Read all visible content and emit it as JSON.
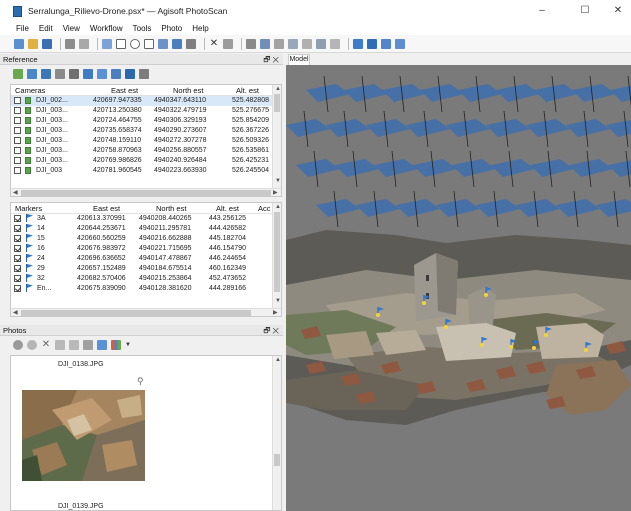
{
  "window": {
    "title": "Serralunga_Rilievo-Drone.psx* — Agisoft PhotoScan",
    "minimize": "–",
    "maximize": "☐",
    "close": "✕"
  },
  "menu": [
    "File",
    "Edit",
    "View",
    "Workflow",
    "Tools",
    "Photo",
    "Help"
  ],
  "reference": {
    "title": "Reference",
    "panel_buttons": "🗗 ✕",
    "cameras": {
      "headers": [
        "Cameras",
        "East est",
        "North est",
        "Alt. est"
      ],
      "rows": [
        {
          "name": "DJI_002...",
          "east": "420697.947335",
          "north": "4940347.643110",
          "alt": "525.482808",
          "selected": true
        },
        {
          "name": "DJI_003...",
          "east": "420713.250380",
          "north": "4940322.479719",
          "alt": "525.276675",
          "selected": false
        },
        {
          "name": "DJI_003...",
          "east": "420724.464755",
          "north": "4940306.329193",
          "alt": "525.854209",
          "selected": false
        },
        {
          "name": "DJI_003...",
          "east": "420735.658374",
          "north": "4940290.273607",
          "alt": "526.367226",
          "selected": false
        },
        {
          "name": "DJI_003...",
          "east": "420748.159110",
          "north": "4940272.307278",
          "alt": "526.509326",
          "selected": false
        },
        {
          "name": "DJI_003...",
          "east": "420758.870963",
          "north": "4940256.880557",
          "alt": "526.535861",
          "selected": false
        },
        {
          "name": "DJI_003...",
          "east": "420769.986826",
          "north": "4940240.926484",
          "alt": "526.425231",
          "selected": false
        },
        {
          "name": "DJI_003",
          "east": "420781.960545",
          "north": "4940223.663930",
          "alt": "526.245504",
          "selected": false
        }
      ]
    },
    "markers": {
      "headers": [
        "Markers",
        "East est",
        "North est",
        "Alt. est",
        "Acc"
      ],
      "rows": [
        {
          "name": "3A",
          "east": "420613.370991",
          "north": "4940208.440265",
          "alt": "443.256125"
        },
        {
          "name": "14",
          "east": "420644.253671",
          "north": "4940211.295781",
          "alt": "444.426582"
        },
        {
          "name": "15",
          "east": "420660.560259",
          "north": "4940216.662888",
          "alt": "445.182704"
        },
        {
          "name": "16",
          "east": "420676.983972",
          "north": "4940221.715695",
          "alt": "446.154790"
        },
        {
          "name": "24",
          "east": "420696.636652",
          "north": "4940147.478867",
          "alt": "446.244654"
        },
        {
          "name": "29",
          "east": "420657.152489",
          "north": "4940184.675514",
          "alt": "460.162349"
        },
        {
          "name": "32",
          "east": "420682.570406",
          "north": "4940215.253864",
          "alt": "452.473652"
        },
        {
          "name": "En...",
          "east": "420675.839090",
          "north": "4940128.381620",
          "alt": "444.289166"
        }
      ]
    }
  },
  "photos": {
    "title": "Photos",
    "panel_buttons": "🗗 ✕",
    "items": [
      "DJI_0138.JPG",
      "DJI_0139.JPG"
    ]
  },
  "model": {
    "tab": "Model"
  }
}
